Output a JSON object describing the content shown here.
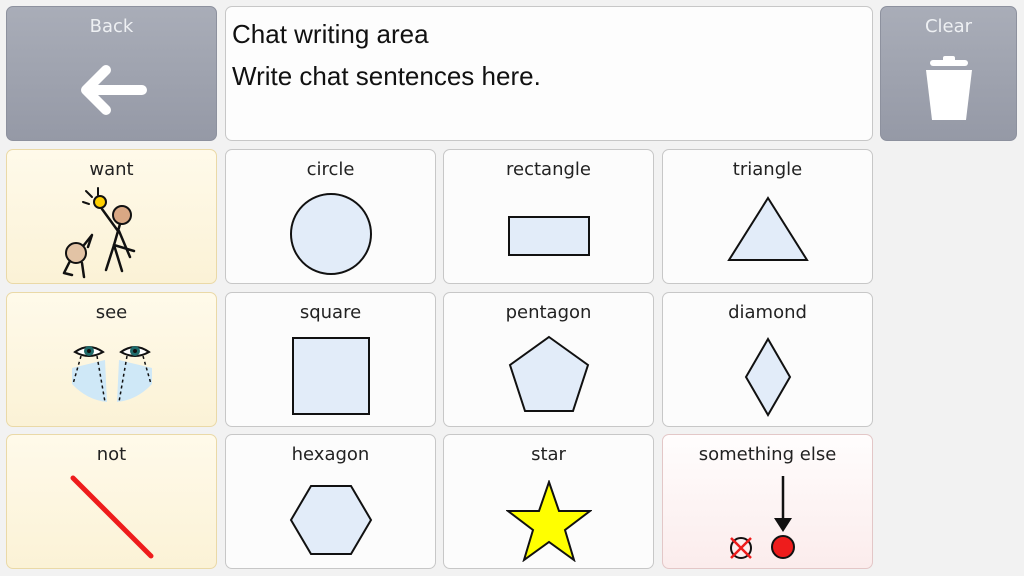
{
  "toolbar": {
    "back_label": "Back",
    "clear_label": "Clear",
    "back_icon": "arrow-left-icon",
    "clear_icon": "trash-icon"
  },
  "chat": {
    "title": "Chat writing area",
    "body": "Write chat sentences here."
  },
  "grid": {
    "want": "want",
    "see": "see",
    "not": "not",
    "circle": "circle",
    "rectangle": "rectangle",
    "triangle": "triangle",
    "square": "square",
    "pentagon": "pentagon",
    "diamond": "diamond",
    "hexagon": "hexagon",
    "star": "star",
    "something_else": "something else"
  },
  "colors": {
    "shape_fill": "#e2ecf9",
    "star_fill": "#ffff00",
    "not_line": "#ee1c1c",
    "button_gray": "#9ea2ae",
    "verb_tile": "#fcf3d9"
  }
}
